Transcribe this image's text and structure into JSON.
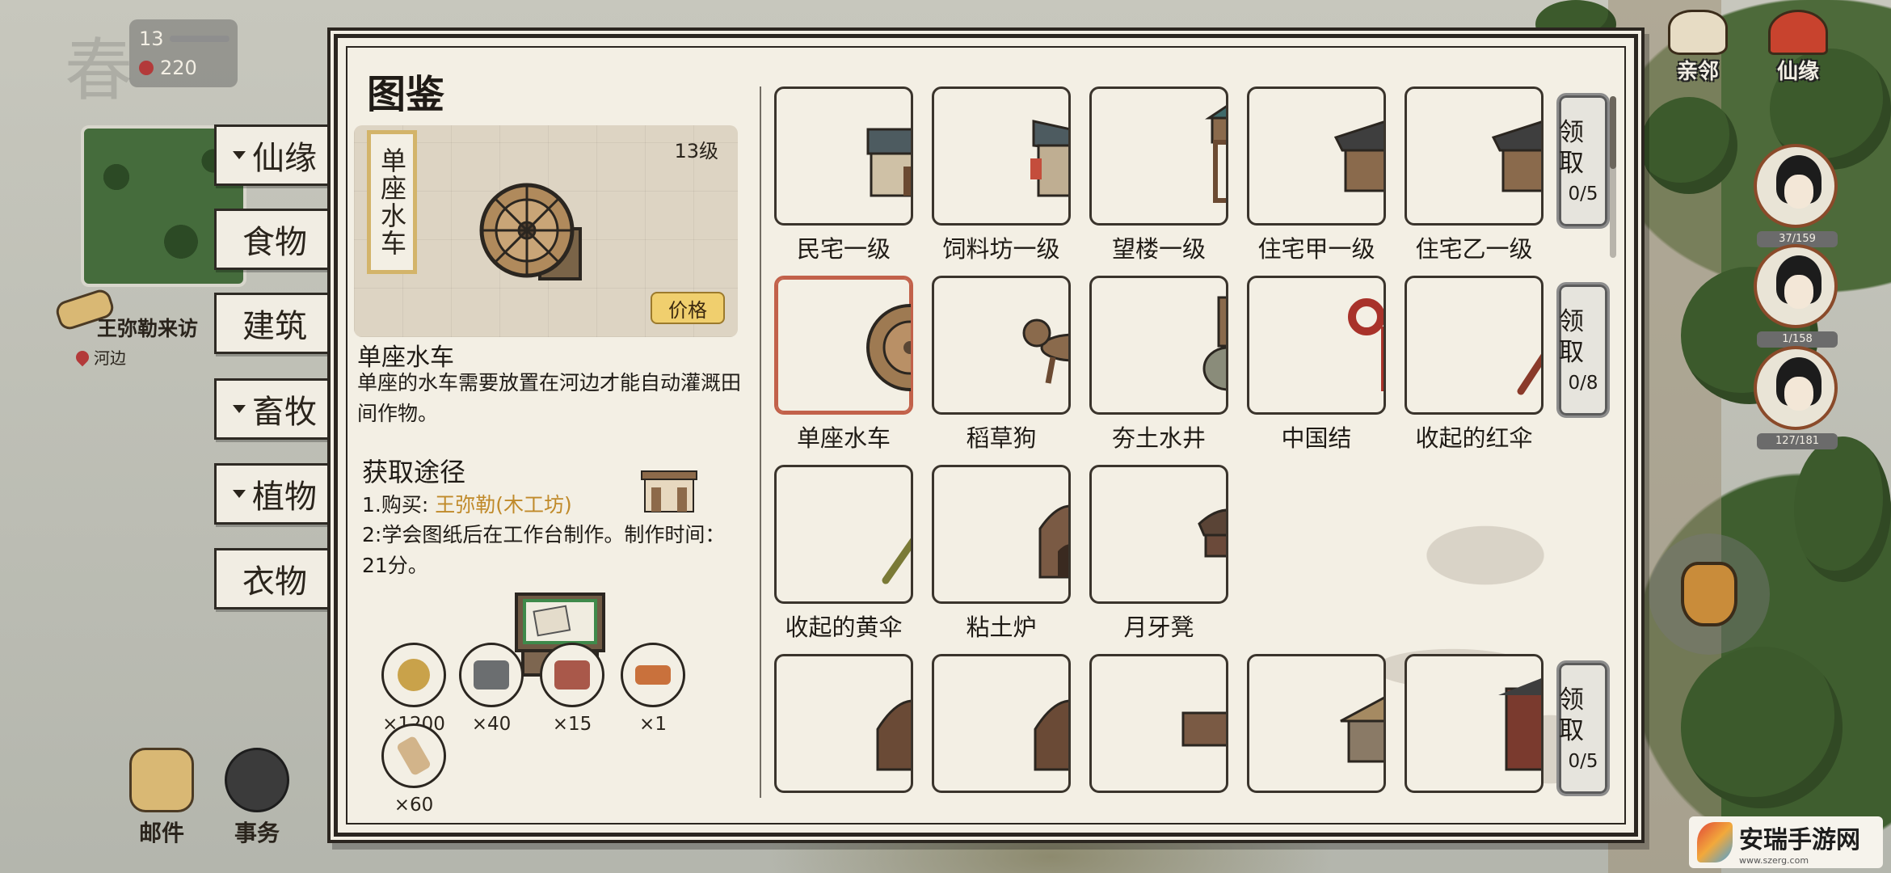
{
  "top_left": {
    "season": "春",
    "stat_value": "13",
    "gems": "220"
  },
  "visitor": {
    "label": "王弥勒来访",
    "location": "河边"
  },
  "left_tabs": [
    {
      "label": "仙缘",
      "has_arrow": true
    },
    {
      "label": "食物",
      "has_arrow": false
    },
    {
      "label": "建筑",
      "has_arrow": false
    },
    {
      "label": "畜牧",
      "has_arrow": true
    },
    {
      "label": "植物",
      "has_arrow": true
    },
    {
      "label": "衣物",
      "has_arrow": false
    }
  ],
  "bottom_buttons": {
    "mail": "邮件",
    "affairs": "事务"
  },
  "top_right": {
    "neighbors": "亲邻",
    "xianyuan": "仙缘"
  },
  "portraits": [
    {
      "hp": "37/159"
    },
    {
      "hp": "1/158"
    },
    {
      "hp": "127/181"
    }
  ],
  "watermark": {
    "title": "安瑞手游网",
    "url": "www.szerg.com"
  },
  "panel": {
    "title": "图鉴",
    "preview": {
      "name_tag": "单座水车",
      "level": "13级",
      "price_label": "价格"
    },
    "item_name": "单座水车",
    "item_desc": "单座的水车需要放置在河边才能自动灌溉田间作物。",
    "obtain_title": "获取途径",
    "obtain_1_prefix": "1.购买: ",
    "obtain_1_merchant": "王弥勒(木工坊)",
    "obtain_2": "2:学会图纸后在工作台制作。制作时间：21分。",
    "materials": [
      "×1200",
      "×40",
      "×15",
      "×1",
      "×60"
    ]
  },
  "grid": {
    "rows": [
      {
        "items": [
          "民宅一级",
          "饲料坊一级",
          "望楼一级",
          "住宅甲一级",
          "住宅乙一级"
        ],
        "claim": {
          "label": "领取",
          "progress": "0/5"
        }
      },
      {
        "items": [
          "单座水车",
          "稻草狗",
          "夯土水井",
          "中国结",
          "收起的红伞"
        ],
        "claim": {
          "label": "领取",
          "progress": "0/8"
        }
      },
      {
        "items": [
          "收起的黄伞",
          "粘土炉",
          "月牙凳"
        ],
        "claim": null
      },
      {
        "items": [
          "",
          "",
          "",
          "",
          ""
        ],
        "claim": {
          "label": "领取",
          "progress": "0/5"
        }
      }
    ],
    "selected": "单座水车"
  },
  "colors": {
    "panel_bg": "#f3efe4",
    "border": "#2b2620",
    "selected_border": "#c2614a",
    "merchant_text": "#c08a2a",
    "price_button": "#f0cf6e"
  }
}
